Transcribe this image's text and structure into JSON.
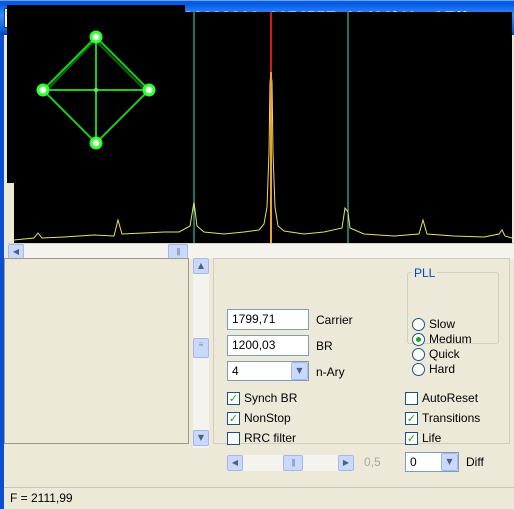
{
  "window": {
    "icon_text": "S A",
    "title": "[TempDir] HDSDR_20130208_035455Z_18498kHz_AF(("
  },
  "fields": {
    "carrier_value": "1799,71",
    "carrier_label": "Carrier",
    "br_value": "1200,03",
    "br_label": "BR",
    "nary_value": "4",
    "nary_label": "n-Ary",
    "diff_value": "0",
    "diff_label": "Diff"
  },
  "checkboxes": {
    "synch_br": {
      "label": "Synch BR",
      "checked": true
    },
    "nonstop": {
      "label": "NonStop",
      "checked": true
    },
    "rrc_filter": {
      "label": "RRC filter",
      "checked": false
    },
    "autoreset": {
      "label": "AutoReset",
      "checked": false
    },
    "transitions": {
      "label": "Transitions",
      "checked": true
    },
    "life": {
      "label": "Life",
      "checked": true
    }
  },
  "pll": {
    "title": "PLL",
    "options": [
      "Slow",
      "Medium",
      "Quick",
      "Hard"
    ],
    "selected": "Medium"
  },
  "slider": {
    "value_label": "0,5",
    "level": 0.5
  },
  "status": {
    "text": "F = 2111,99"
  },
  "colors": {
    "spectrum_trace": "#e8e060",
    "marker_cyan": "#40e0d0",
    "marker_red": "#d81818",
    "constellation": "#20e020"
  }
}
